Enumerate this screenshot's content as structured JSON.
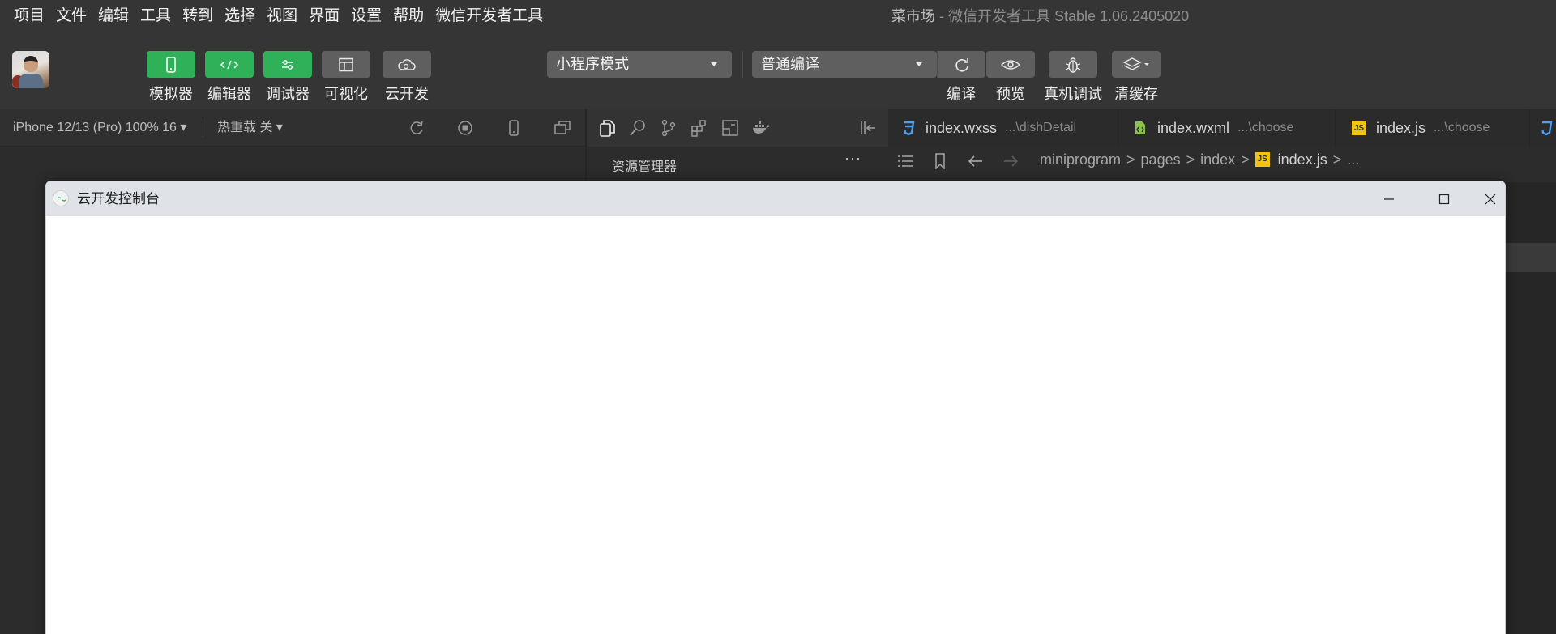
{
  "menu": [
    "项目",
    "文件",
    "编辑",
    "工具",
    "转到",
    "选择",
    "视图",
    "界面",
    "设置",
    "帮助",
    "微信开发者工具"
  ],
  "title": {
    "project": "菜市场",
    "separator": " - ",
    "app": "微信开发者工具 Stable 1.06.2405020"
  },
  "toolbar": {
    "simulator": "模拟器",
    "editor": "编辑器",
    "debugger": "调试器",
    "visual": "可视化",
    "cloud": "云开发",
    "mode": "小程序模式",
    "compile_mode": "普通编译",
    "compile": "编译",
    "preview": "预览",
    "remote_debug": "真机调试",
    "clear_cache": "清缓存"
  },
  "simbar": {
    "device": "iPhone 12/13 (Pro) 100% 16 ▾",
    "hot_reload": "热重载 关 ▾"
  },
  "tabs": [
    {
      "name": "index.wxss",
      "path": "...\\dishDetail",
      "icon": "css-icon",
      "color": "#4f9ff0"
    },
    {
      "name": "index.wxml",
      "path": "...\\choose",
      "icon": "wxml-icon",
      "color": "#8bc34a"
    },
    {
      "name": "index.js",
      "path": "...\\choose",
      "icon": "js-icon",
      "color": "#f1c40f"
    }
  ],
  "explorer": {
    "title": "资源管理器",
    "more": "···"
  },
  "breadcrumb": {
    "parts": [
      "miniprogram",
      "pages",
      "index"
    ],
    "file": "index.js",
    "tail": "..."
  },
  "console_window": {
    "title": "云开发控制台"
  },
  "colors": {
    "accent_green": "#2fb15a",
    "window_titlebar": "#dfe3e8",
    "background": "#2c2c2c"
  }
}
